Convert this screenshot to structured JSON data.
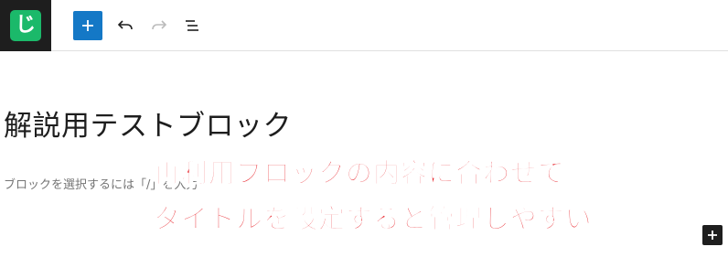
{
  "toolbar": {
    "site_icon_char": "じ",
    "buttons": [
      "add-block",
      "undo",
      "redo",
      "document-overview"
    ]
  },
  "editor": {
    "title": "解説用テストブロック",
    "placeholder": "ブロックを選択するには「/」を入力"
  },
  "overlay": {
    "line1": "再利用ブロックの内容に合わせて",
    "line2": "タイトルを設定すると管理しやすい"
  },
  "colors": {
    "accent": "#1478c6",
    "logo_green": "#1bb96a",
    "overlay_red": "#e8252c",
    "dark": "#1e1e1e"
  }
}
